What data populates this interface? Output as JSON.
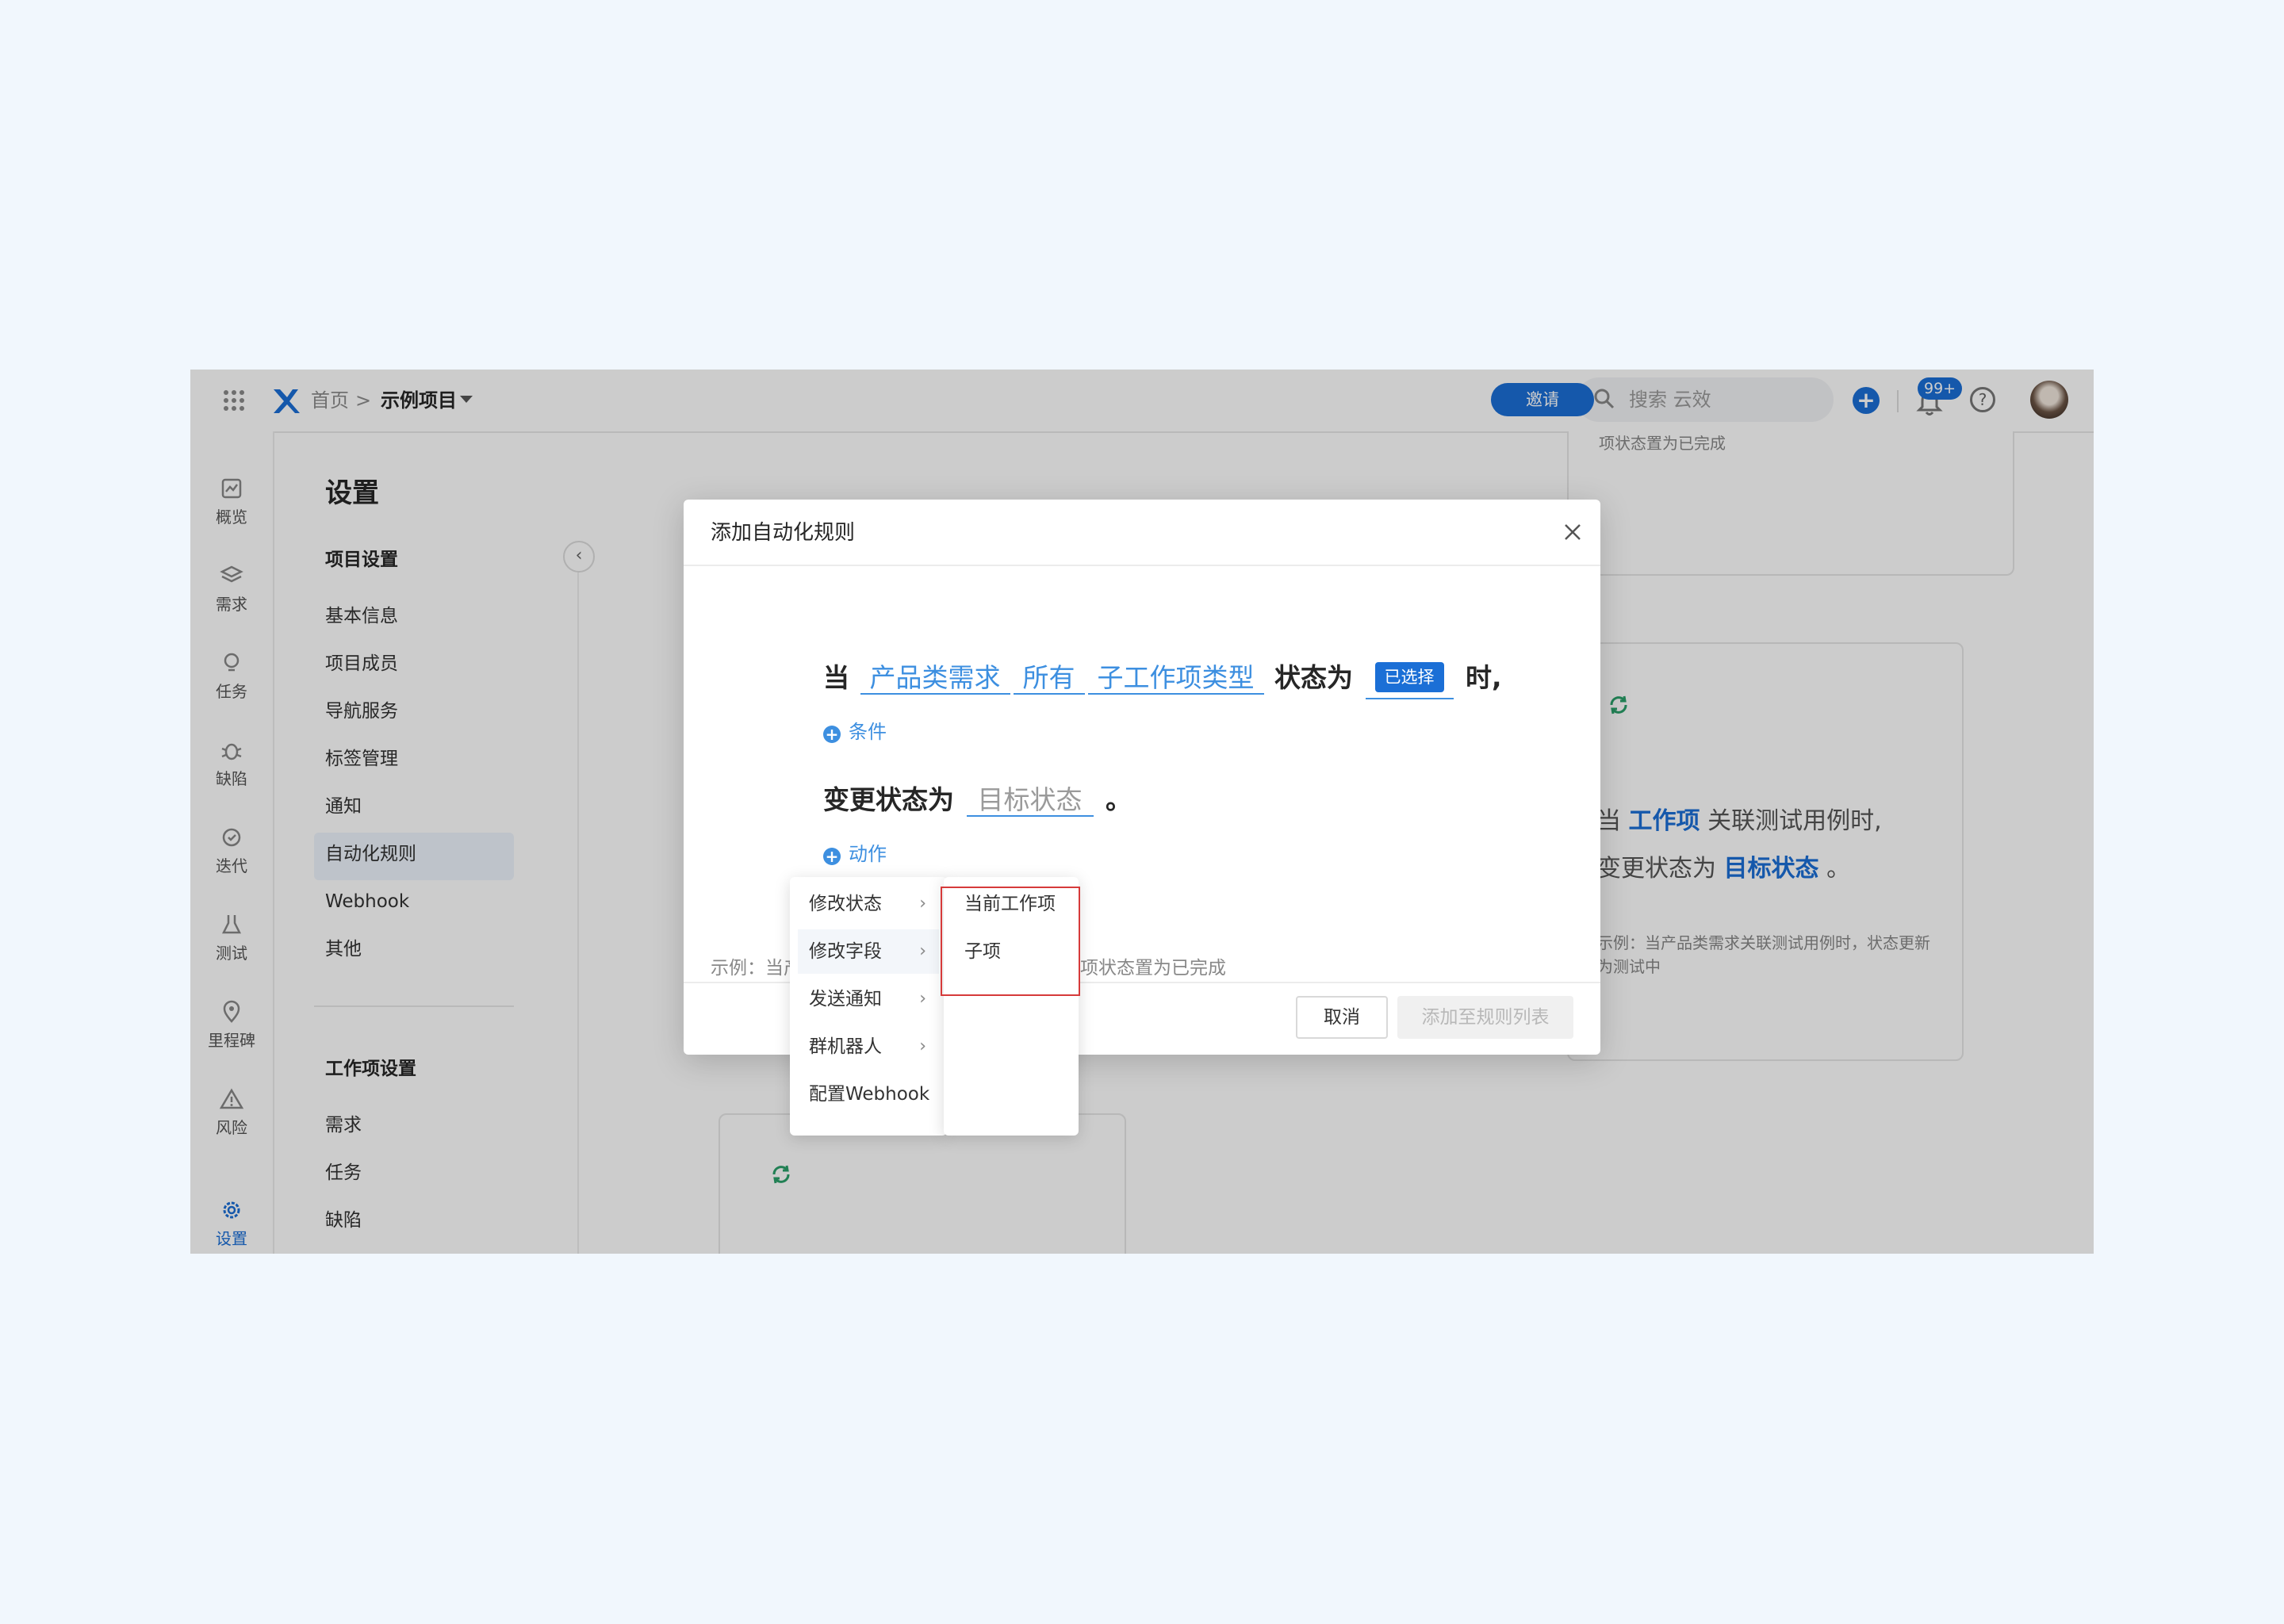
{
  "header": {
    "breadcrumb_home": "首页",
    "breadcrumb_sep": ">",
    "project_name": "示例项目",
    "invite_label": "邀请",
    "search_placeholder": "搜索 云效",
    "notification_count": "99+",
    "help_label": "?",
    "plus_label": "+"
  },
  "rail": {
    "items": [
      {
        "label": "概览",
        "icon": "chart-icon"
      },
      {
        "label": "需求",
        "icon": "layers-icon"
      },
      {
        "label": "任务",
        "icon": "bulb-icon"
      },
      {
        "label": "缺陷",
        "icon": "bug-icon"
      },
      {
        "label": "迭代",
        "icon": "cycle-icon"
      },
      {
        "label": "测试",
        "icon": "flask-icon"
      },
      {
        "label": "里程碑",
        "icon": "pin-icon"
      },
      {
        "label": "风险",
        "icon": "warning-icon"
      },
      {
        "label": "设置",
        "icon": "gear-icon"
      }
    ]
  },
  "settings": {
    "title": "设置",
    "project_section": "项目设置",
    "project_items": [
      "基本信息",
      "项目成员",
      "导航服务",
      "标签管理",
      "通知",
      "自动化规则",
      "Webhook",
      "其他"
    ],
    "active_item": "自动化规则",
    "workitem_section": "工作项设置",
    "workitem_items": [
      "需求",
      "任务",
      "缺陷"
    ]
  },
  "background_cards": {
    "top_snippet": "项状态置为已完成",
    "right_card": {
      "line1_pre": "当",
      "line1_token": "工作项",
      "line1_post": "关联测试用例时,",
      "line2_pre": "变更状态为",
      "line2_token": "目标状态",
      "line2_post": "。",
      "example": "示例：当产品类需求关联测试用例时，状态更新为测试中"
    }
  },
  "modal": {
    "title": "添加自动化规则",
    "rule": {
      "when": "当",
      "token1": "产品类需求",
      "token2": "所有",
      "token3": "子工作项类型",
      "status_text": "状态为",
      "selected_chip": "已选择",
      "then_text": "时,",
      "add_condition": "条件",
      "change_text": "变更状态为",
      "target_placeholder": "目标状态",
      "period": "。",
      "add_action": "动作"
    },
    "example_left": "示例：当产",
    "example_right": "项状态置为已完成",
    "cancel_label": "取消",
    "add_label": "添加至规则列表"
  },
  "action_menu": {
    "items": [
      {
        "label": "修改状态",
        "has_sub": true
      },
      {
        "label": "修改字段",
        "has_sub": true
      },
      {
        "label": "发送通知",
        "has_sub": true
      },
      {
        "label": "群机器人",
        "has_sub": true
      },
      {
        "label": "配置Webhook",
        "has_sub": false
      }
    ],
    "active_index": 1,
    "submenu_items": [
      "当前工作项",
      "子项"
    ]
  },
  "colors": {
    "accent": "#1b6fd6",
    "token": "#3d8fe0",
    "highlight_box": "#d63a3a",
    "page_bg": "#f1f7fd"
  }
}
